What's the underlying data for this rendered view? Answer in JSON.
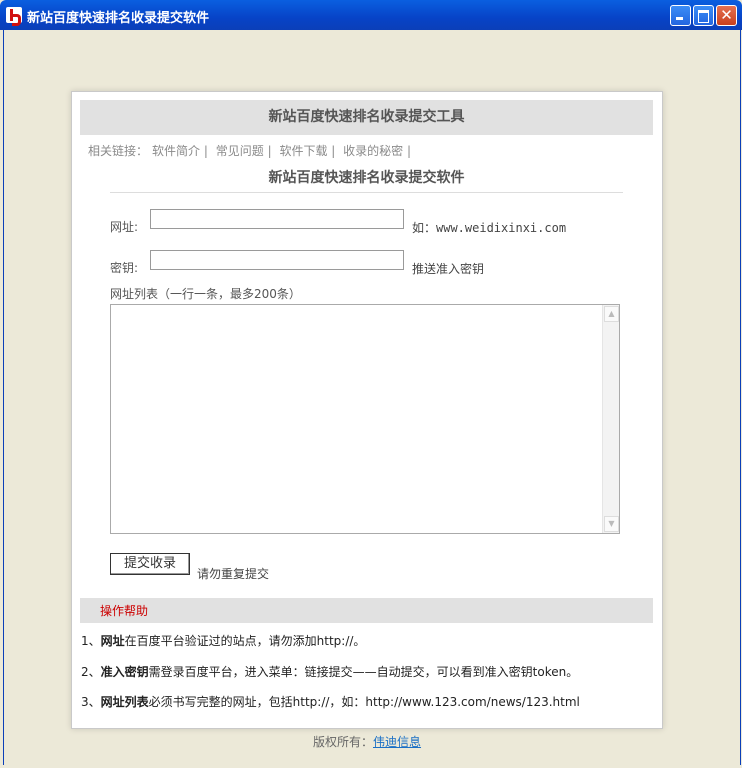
{
  "window": {
    "title": "新站百度快速排名收录提交软件",
    "icon": "app-logo-icon",
    "close_glyph": "✕"
  },
  "card": {
    "header": "新站百度快速排名收录提交工具",
    "nav": {
      "prefix": "相关链接：",
      "links": [
        "软件简介",
        "常见问题",
        "软件下载",
        "收录的秘密"
      ],
      "separator": "|"
    },
    "subtitle": "新站百度快速排名收录提交软件"
  },
  "form": {
    "url_label": "网址:",
    "url_value": "",
    "url_hint": "如：www.weidixinxi.com",
    "key_label": "密钥:",
    "key_value": "",
    "key_hint": "推送准入密钥",
    "list_label": "网址列表（一行一条，最多200条）",
    "list_value": "",
    "submit_label": "提交收录",
    "submit_note": "请勿重复提交"
  },
  "help": {
    "title": "操作帮助",
    "items": [
      {
        "num": "1、",
        "bold": "网址",
        "text": "在百度平台验证过的站点，请勿添加http://。"
      },
      {
        "num": "2、",
        "bold": "准入密钥",
        "text": "需登录百度平台，进入菜单：链接提交——自动提交，可以看到准入密钥token。"
      },
      {
        "num": "3、",
        "bold": "网址列表",
        "text": "必须书写完整的网址，包括http://，如：http://www.123.com/news/123.html"
      }
    ]
  },
  "footer": {
    "prefix": "版权所有：",
    "link": "伟迪信息"
  },
  "colors": {
    "titlebar": "#0743c7",
    "header_bg": "#e1e1e1",
    "help_title": "#cc0000",
    "footer_link": "#1a6fc5"
  }
}
